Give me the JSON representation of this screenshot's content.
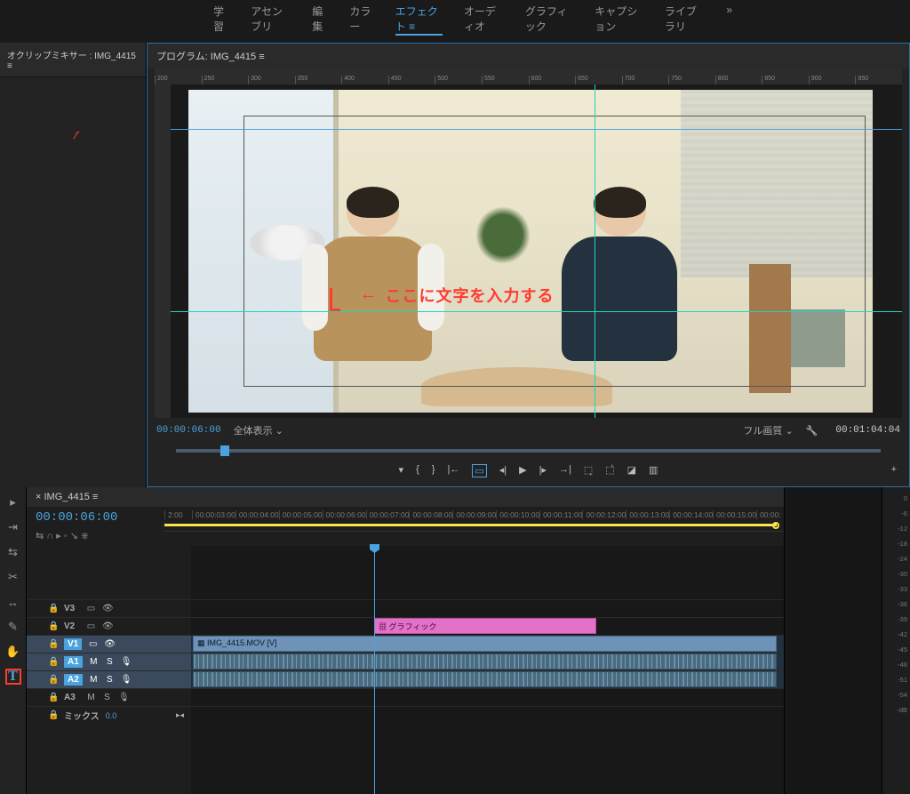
{
  "workspace_tabs": {
    "items": [
      "学習",
      "アセンブリ",
      "編集",
      "カラー",
      "エフェクト",
      "オーディオ",
      "グラフィック",
      "キャプション",
      "ライブラリ"
    ],
    "active_index": 4,
    "more": "»"
  },
  "mixer_panel": {
    "title": "オクリップミキサー : IMG_4415 ≡"
  },
  "program_panel": {
    "title_prefix": "プログラム:",
    "clip_name": "IMG_4415 ≡",
    "current_tc": "00:00:06:00",
    "fit_label": "全体表示",
    "quality_label": "フル画質",
    "end_tc": "00:01:04:04",
    "ruler_ticks": [
      "200",
      "250",
      "300",
      "350",
      "400",
      "450",
      "500",
      "550",
      "600",
      "650",
      "700",
      "750",
      "800",
      "850",
      "900",
      "950"
    ]
  },
  "annotation": {
    "arrow": "←",
    "text": "ここに文字を入力する"
  },
  "transport": {
    "icons": [
      "shield",
      "brace-open",
      "brace-close",
      "goto-in",
      "frame",
      "step-back",
      "play",
      "step-fwd",
      "goto-out",
      "export",
      "camera",
      "snapshot",
      "compare"
    ],
    "plus": "+"
  },
  "tools": {
    "items": [
      "selection",
      "track-select",
      "ripple",
      "razor",
      "slip",
      "pen",
      "hand",
      "type"
    ],
    "type_glyph": "T"
  },
  "timeline": {
    "tab_name": "IMG_4415 ≡",
    "current_tc": "00:00:06:00",
    "header_icons": "⇆  ∩  ▸  ◦  ↘  ⎈",
    "time_ticks": [
      "2:00",
      "00:00:03:00",
      "00:00:04:00",
      "00:00:05:00",
      "00:00:06:00",
      "00:00:07:00",
      "00:00:08:00",
      "00:00:09:00",
      "00:00:10:00",
      "00:00:11:00",
      "00:00:12:00",
      "00:00:13:00",
      "00:00:14:00",
      "00:00:15:00",
      "00:00:"
    ],
    "tracks": {
      "v3": "V3",
      "v2": "V2",
      "v1": "V1",
      "a1": "A1",
      "a2": "A2",
      "a3": "A3",
      "mix_label": "ミックス",
      "mix_value": "0.0",
      "m": "M",
      "s": "S"
    },
    "clips": {
      "video_name": "IMG_4415.MOV [V]",
      "graphic_name": "グラフィック"
    }
  },
  "audio_meter": {
    "scale": [
      "0",
      "-6",
      "-12",
      "-18",
      "-24",
      "-30",
      "-33",
      "-36",
      "-39",
      "-42",
      "-45",
      "-48",
      "-51",
      "-54",
      "-dB"
    ]
  }
}
